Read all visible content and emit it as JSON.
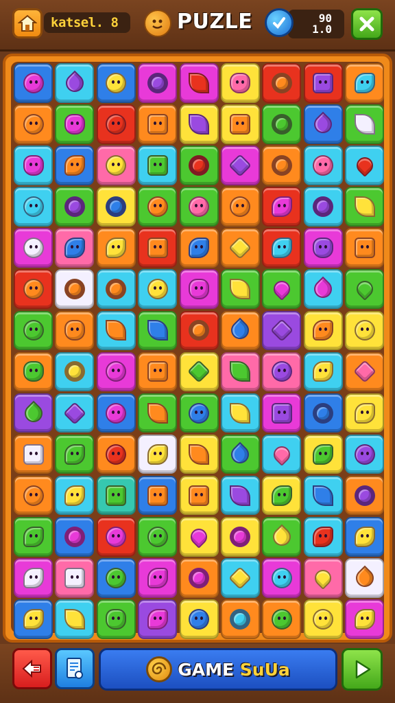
{
  "header": {
    "player_name": "katsel. 8",
    "title": "PUZLE",
    "score_top": "90",
    "score_bottom": "1.0"
  },
  "footer": {
    "banner_main": "GAME ",
    "banner_accent": "SuUa"
  },
  "palette": {
    "blue": "#2f7fe8",
    "cyan": "#3fd0f0",
    "yellow": "#ffe23a",
    "orange": "#ff8a1e",
    "red": "#e8321e",
    "green": "#4cc830",
    "magenta": "#e83ad8",
    "purple": "#9a4ae0",
    "pink": "#ff6aa8",
    "white": "#f4f0ff",
    "teal": "#36c8b0"
  },
  "board": {
    "rows": [
      [
        [
          "blue",
          "magenta",
          "blob"
        ],
        [
          "cyan",
          "purple",
          "drop"
        ],
        [
          "blue",
          "yellow",
          "blob"
        ],
        [
          "magenta",
          "purple",
          "ring"
        ],
        [
          "magenta",
          "red",
          "leaf"
        ],
        [
          "yellow",
          "pink",
          "round"
        ],
        [
          "red",
          "orange",
          "ring"
        ],
        [
          "red",
          "purple",
          "square"
        ],
        [
          "orange",
          "cyan",
          "star"
        ]
      ],
      [
        [
          "orange",
          "orange",
          "blob"
        ],
        [
          "green",
          "magenta",
          "round"
        ],
        [
          "red",
          "red",
          "blob"
        ],
        [
          "orange",
          "orange",
          "square"
        ],
        [
          "yellow",
          "purple",
          "leaf"
        ],
        [
          "yellow",
          "orange",
          "square"
        ],
        [
          "green",
          "green",
          "ring"
        ],
        [
          "blue",
          "purple",
          "drop"
        ],
        [
          "green",
          "white",
          "leaf"
        ]
      ],
      [
        [
          "cyan",
          "magenta",
          "round"
        ],
        [
          "blue",
          "orange",
          "star"
        ],
        [
          "pink",
          "yellow",
          "blob"
        ],
        [
          "cyan",
          "green",
          "square"
        ],
        [
          "green",
          "red",
          "ring"
        ],
        [
          "magenta",
          "purple",
          "diamond"
        ],
        [
          "orange",
          "orange",
          "ring"
        ],
        [
          "cyan",
          "pink",
          "blob"
        ],
        [
          "cyan",
          "red",
          "heart"
        ]
      ],
      [
        [
          "cyan",
          "cyan",
          "blob"
        ],
        [
          "green",
          "purple",
          "ring"
        ],
        [
          "yellow",
          "blue",
          "ring"
        ],
        [
          "green",
          "orange",
          "blob"
        ],
        [
          "green",
          "pink",
          "blob"
        ],
        [
          "orange",
          "orange",
          "blob"
        ],
        [
          "red",
          "magenta",
          "star"
        ],
        [
          "cyan",
          "purple",
          "ring"
        ],
        [
          "green",
          "yellow",
          "leaf"
        ]
      ],
      [
        [
          "magenta",
          "white",
          "blob"
        ],
        [
          "pink",
          "blue",
          "star"
        ],
        [
          "orange",
          "yellow",
          "star"
        ],
        [
          "red",
          "orange",
          "square"
        ],
        [
          "orange",
          "blue",
          "star"
        ],
        [
          "orange",
          "yellow",
          "diamond"
        ],
        [
          "red",
          "cyan",
          "star"
        ],
        [
          "magenta",
          "purple",
          "round"
        ],
        [
          "orange",
          "orange",
          "square"
        ]
      ],
      [
        [
          "red",
          "orange",
          "blob"
        ],
        [
          "white",
          "orange",
          "ring"
        ],
        [
          "cyan",
          "orange",
          "ring"
        ],
        [
          "cyan",
          "yellow",
          "blob"
        ],
        [
          "magenta",
          "magenta",
          "round"
        ],
        [
          "green",
          "yellow",
          "leaf"
        ],
        [
          "green",
          "magenta",
          "heart"
        ],
        [
          "cyan",
          "magenta",
          "drop"
        ],
        [
          "green",
          "green",
          "heart"
        ]
      ],
      [
        [
          "green",
          "green",
          "blob"
        ],
        [
          "orange",
          "orange",
          "round"
        ],
        [
          "cyan",
          "orange",
          "leaf"
        ],
        [
          "green",
          "blue",
          "leaf"
        ],
        [
          "red",
          "orange",
          "ring"
        ],
        [
          "orange",
          "blue",
          "drop"
        ],
        [
          "purple",
          "purple",
          "diamond"
        ],
        [
          "yellow",
          "orange",
          "star"
        ],
        [
          "yellow",
          "yellow",
          "blob"
        ]
      ],
      [
        [
          "orange",
          "green",
          "round"
        ],
        [
          "cyan",
          "yellow",
          "ring"
        ],
        [
          "magenta",
          "magenta",
          "blob"
        ],
        [
          "orange",
          "orange",
          "square"
        ],
        [
          "yellow",
          "green",
          "diamond"
        ],
        [
          "pink",
          "green",
          "leaf"
        ],
        [
          "pink",
          "purple",
          "blob"
        ],
        [
          "cyan",
          "yellow",
          "star"
        ],
        [
          "orange",
          "pink",
          "diamond"
        ]
      ],
      [
        [
          "purple",
          "green",
          "drop"
        ],
        [
          "cyan",
          "purple",
          "diamond"
        ],
        [
          "blue",
          "magenta",
          "blob"
        ],
        [
          "green",
          "orange",
          "leaf"
        ],
        [
          "green",
          "blue",
          "blob"
        ],
        [
          "cyan",
          "yellow",
          "leaf"
        ],
        [
          "magenta",
          "purple",
          "square"
        ],
        [
          "blue",
          "blue",
          "ring"
        ],
        [
          "yellow",
          "yellow",
          "star"
        ]
      ],
      [
        [
          "orange",
          "white",
          "square"
        ],
        [
          "green",
          "green",
          "star"
        ],
        [
          "orange",
          "red",
          "blob"
        ],
        [
          "white",
          "yellow",
          "star"
        ],
        [
          "yellow",
          "orange",
          "leaf"
        ],
        [
          "green",
          "blue",
          "drop"
        ],
        [
          "cyan",
          "pink",
          "heart"
        ],
        [
          "yellow",
          "green",
          "star"
        ],
        [
          "cyan",
          "purple",
          "blob"
        ]
      ],
      [
        [
          "orange",
          "orange",
          "blob"
        ],
        [
          "cyan",
          "yellow",
          "star"
        ],
        [
          "teal",
          "green",
          "square"
        ],
        [
          "blue",
          "orange",
          "square"
        ],
        [
          "yellow",
          "orange",
          "square"
        ],
        [
          "cyan",
          "purple",
          "leaf"
        ],
        [
          "yellow",
          "green",
          "star"
        ],
        [
          "cyan",
          "blue",
          "leaf"
        ],
        [
          "orange",
          "purple",
          "ring"
        ]
      ],
      [
        [
          "green",
          "green",
          "star"
        ],
        [
          "blue",
          "magenta",
          "ring"
        ],
        [
          "red",
          "magenta",
          "blob"
        ],
        [
          "green",
          "green",
          "blob"
        ],
        [
          "yellow",
          "magenta",
          "heart"
        ],
        [
          "yellow",
          "magenta",
          "ring"
        ],
        [
          "green",
          "yellow",
          "drop"
        ],
        [
          "cyan",
          "red",
          "star"
        ],
        [
          "blue",
          "yellow",
          "star"
        ]
      ],
      [
        [
          "magenta",
          "white",
          "star"
        ],
        [
          "pink",
          "white",
          "square"
        ],
        [
          "blue",
          "green",
          "blob"
        ],
        [
          "magenta",
          "magenta",
          "star"
        ],
        [
          "orange",
          "magenta",
          "ring"
        ],
        [
          "cyan",
          "yellow",
          "diamond"
        ],
        [
          "magenta",
          "cyan",
          "blob"
        ],
        [
          "pink",
          "yellow",
          "heart"
        ],
        [
          "white",
          "orange",
          "drop"
        ]
      ],
      [
        [
          "blue",
          "yellow",
          "star"
        ],
        [
          "cyan",
          "yellow",
          "leaf"
        ],
        [
          "green",
          "green",
          "round"
        ],
        [
          "purple",
          "magenta",
          "star"
        ],
        [
          "yellow",
          "blue",
          "blob"
        ],
        [
          "orange",
          "cyan",
          "ring"
        ],
        [
          "orange",
          "green",
          "blob"
        ],
        [
          "yellow",
          "yellow",
          "blob"
        ],
        [
          "magenta",
          "yellow",
          "star"
        ]
      ]
    ]
  }
}
